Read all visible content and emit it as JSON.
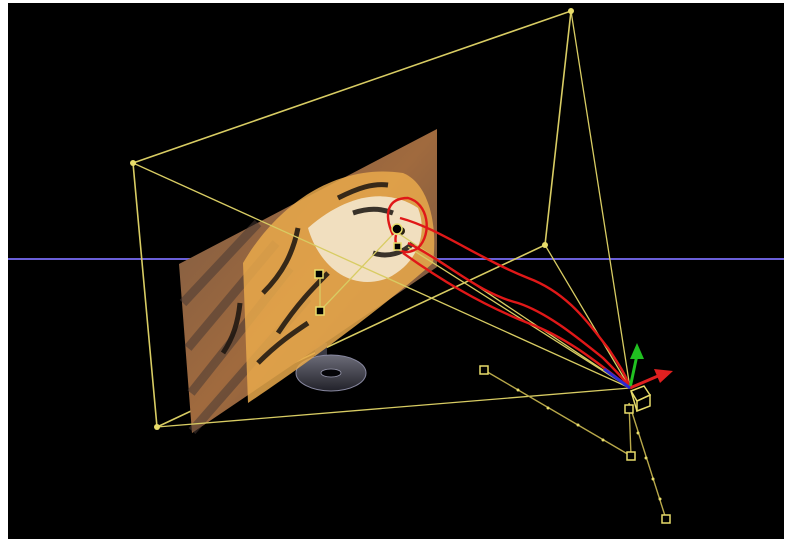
{
  "viewport": {
    "background": "#000000",
    "horizon_color": "#6a5fd8",
    "frame_color": "#d8cc63",
    "curve_color": "#e01818",
    "texture": "tiger-face-image",
    "axes": {
      "y_color": "#20c020",
      "x_color": "#e02020",
      "z_color": "#2a2ad0"
    }
  }
}
